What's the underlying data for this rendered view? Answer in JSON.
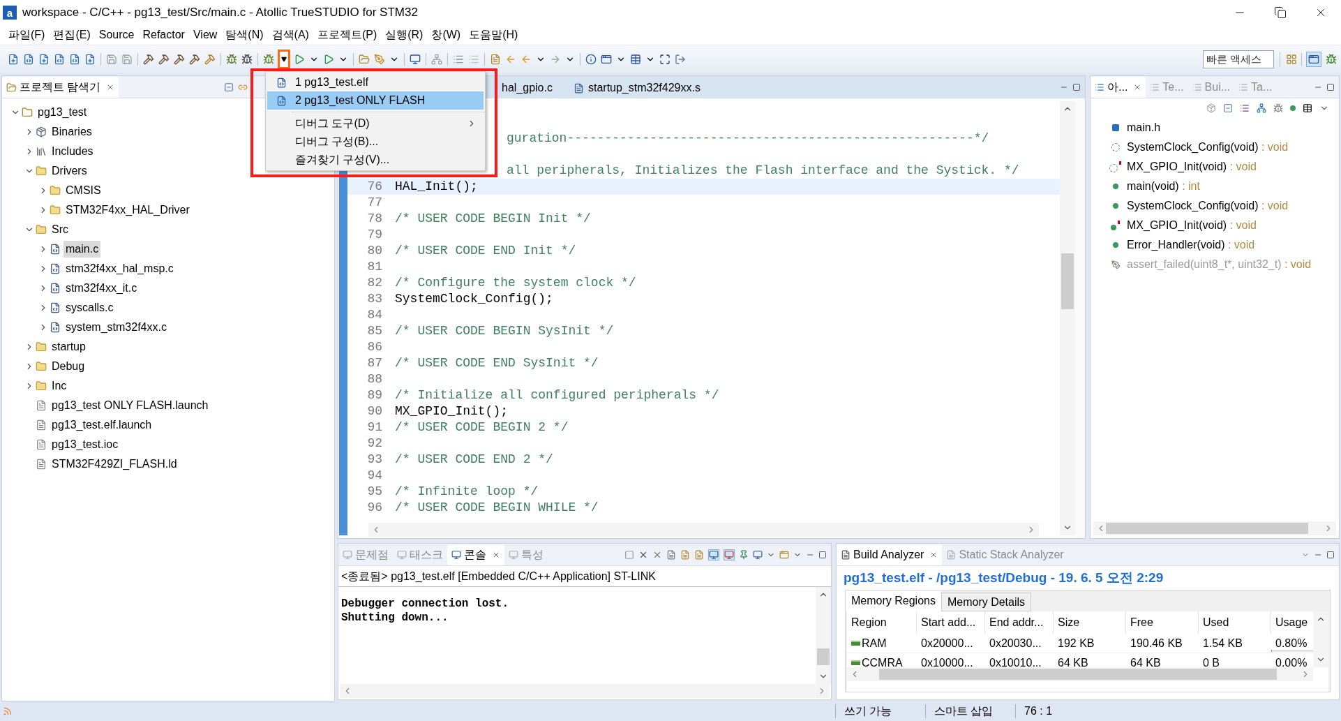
{
  "window": {
    "logo": "a",
    "title": "workspace - C/C++ - pg13_test/Src/main.c - Atollic TrueSTUDIO for STM32"
  },
  "menu_bar": [
    "파일(F)",
    "편집(E)",
    "Source",
    "Refactor",
    "View",
    "탐색(N)",
    "검색(A)",
    "프로젝트(P)",
    "실행(R)",
    "창(W)",
    "도움말(H)"
  ],
  "toolbar": {
    "quick_access": {
      "placeholder": "빠른 액세스"
    }
  },
  "debug_menu": {
    "items": [
      {
        "kind": "launch",
        "label": "1 pg13_test.elf",
        "selected": false
      },
      {
        "kind": "launch",
        "label": "2 pg13_test ONLY FLASH",
        "selected": true
      },
      {
        "kind": "separator"
      },
      {
        "kind": "submenu",
        "label": "디버그 도구(D)",
        "selected": false
      },
      {
        "kind": "plain",
        "label": "디버그 구성(B)...",
        "selected": false
      },
      {
        "kind": "plain",
        "label": "즐겨찾기 구성(V)...",
        "selected": false
      }
    ]
  },
  "project_explorer": {
    "tab": "프로젝트 탐색기",
    "tree": [
      {
        "kind": "project",
        "label": "pg13_test",
        "expanded": true,
        "selected": false,
        "children": [
          {
            "kind": "binaries",
            "label": "Binaries",
            "expanded": false,
            "selected": false
          },
          {
            "kind": "includes",
            "label": "Includes",
            "expanded": false,
            "selected": false
          },
          {
            "kind": "folder",
            "label": "Drivers",
            "expanded": true,
            "selected": false,
            "children": [
              {
                "kind": "folder",
                "label": "CMSIS",
                "expanded": false,
                "selected": false
              },
              {
                "kind": "folder",
                "label": "STM32F4xx_HAL_Driver",
                "expanded": false,
                "selected": false
              }
            ]
          },
          {
            "kind": "folder",
            "label": "Src",
            "expanded": true,
            "selected": false,
            "children": [
              {
                "kind": "source",
                "label": "main.c",
                "expanded": false,
                "selected": true
              },
              {
                "kind": "source",
                "label": "stm32f4xx_hal_msp.c",
                "expanded": false,
                "selected": false
              },
              {
                "kind": "source",
                "label": "stm32f4xx_it.c",
                "expanded": false,
                "selected": false
              },
              {
                "kind": "source",
                "label": "syscalls.c",
                "expanded": false,
                "selected": false
              },
              {
                "kind": "source",
                "label": "system_stm32f4xx.c",
                "expanded": false,
                "selected": false
              }
            ]
          },
          {
            "kind": "folder",
            "label": "startup",
            "expanded": false,
            "selected": false
          },
          {
            "kind": "folder",
            "label": "Debug",
            "expanded": false,
            "selected": false
          },
          {
            "kind": "folder",
            "label": "Inc",
            "expanded": false,
            "selected": false
          },
          {
            "kind": "file",
            "label": "pg13_test ONLY FLASH.launch",
            "selected": false
          },
          {
            "kind": "file",
            "label": "pg13_test.elf.launch",
            "selected": false
          },
          {
            "kind": "file",
            "label": "pg13_test.ioc",
            "selected": false
          },
          {
            "kind": "file",
            "label": "STM32F429ZI_FLASH.ld",
            "selected": false
          }
        ]
      }
    ]
  },
  "editor": {
    "tabs": [
      {
        "label": "hal_gpio.c",
        "selected": false
      },
      {
        "label": "startup_stm32f429xx.s",
        "selected": false
      }
    ],
    "lines": [
      {
        "kind": "clipped",
        "text": "guration------------------------------------------------------*/",
        "current": false
      },
      {
        "kind": "clipped",
        "text": "all peripherals, Initializes the Flash interface and the Systick. */",
        "current": false
      },
      {
        "kind": "code",
        "number": "76",
        "text": "HAL_Init();",
        "current": true
      },
      {
        "kind": "blank",
        "number": "77",
        "current": false
      },
      {
        "kind": "comment",
        "number": "78",
        "text": "/* USER CODE BEGIN Init */",
        "current": false
      },
      {
        "kind": "blank",
        "number": "79",
        "current": false
      },
      {
        "kind": "comment",
        "number": "80",
        "text": "/* USER CODE END Init */",
        "current": false
      },
      {
        "kind": "blank",
        "number": "81",
        "current": false
      },
      {
        "kind": "comment",
        "number": "82",
        "text": "/* Configure the system clock */",
        "current": false
      },
      {
        "kind": "code",
        "number": "83",
        "text": "SystemClock_Config();",
        "current": false
      },
      {
        "kind": "blank",
        "number": "84",
        "current": false
      },
      {
        "kind": "comment",
        "number": "85",
        "text": "/* USER CODE BEGIN SysInit */",
        "current": false
      },
      {
        "kind": "blank",
        "number": "86",
        "current": false
      },
      {
        "kind": "comment",
        "number": "87",
        "text": "/* USER CODE END SysInit */",
        "current": false
      },
      {
        "kind": "blank",
        "number": "88",
        "current": false
      },
      {
        "kind": "comment",
        "number": "89",
        "text": "/* Initialize all configured peripherals */",
        "current": false
      },
      {
        "kind": "code",
        "number": "90",
        "text": "MX_GPIO_Init();",
        "current": false
      },
      {
        "kind": "comment",
        "number": "91",
        "text": "/* USER CODE BEGIN 2 */",
        "current": false
      },
      {
        "kind": "blank",
        "number": "92",
        "current": false
      },
      {
        "kind": "comment",
        "number": "93",
        "text": "/* USER CODE END 2 */",
        "current": false
      },
      {
        "kind": "blank",
        "number": "94",
        "current": false
      },
      {
        "kind": "comment",
        "number": "95",
        "text": "/* Infinite loop */",
        "current": false
      },
      {
        "kind": "comment",
        "number": "96",
        "text": "/* USER CODE BEGIN WHILE */",
        "current": false
      }
    ]
  },
  "outline": {
    "tabs": [
      {
        "label": "아...",
        "selected": true
      },
      {
        "label": "Te...",
        "selected": false
      },
      {
        "label": "Bui...",
        "selected": false
      },
      {
        "label": "Ta...",
        "selected": false
      }
    ],
    "items": [
      {
        "kind": "include",
        "name": "main.h"
      },
      {
        "kind": "declaration",
        "name": "SystemClock_Config(void)",
        "type": ": void"
      },
      {
        "kind": "static-declaration",
        "name": "MX_GPIO_Init(void)",
        "type": ": void"
      },
      {
        "kind": "function",
        "name": "main(void)",
        "type": ": int"
      },
      {
        "kind": "function",
        "name": "SystemClock_Config(void)",
        "type": ": void"
      },
      {
        "kind": "static-function",
        "name": "MX_GPIO_Init(void)",
        "type": ": void"
      },
      {
        "kind": "function",
        "name": "Error_Handler(void)",
        "type": ": void"
      },
      {
        "kind": "inactive",
        "name": "assert_failed(uint8_t*, uint32_t)",
        "type": ": void"
      }
    ]
  },
  "console": {
    "tabs": [
      {
        "label": "문제점",
        "selected": false
      },
      {
        "label": "태스크",
        "selected": false
      },
      {
        "label": "콘솔",
        "selected": true
      },
      {
        "label": "특성",
        "selected": false
      }
    ],
    "status": "<종료됨> pg13_test.elf [Embedded C/C++ Application] ST-LINK",
    "output": [
      "Debugger connection lost.",
      "Shutting down..."
    ]
  },
  "build_analyzer": {
    "tabs": [
      {
        "label": "Build Analyzer",
        "selected": true
      },
      {
        "label": "Static Stack Analyzer",
        "selected": false
      }
    ],
    "heading": "pg13_test.elf - /pg13_test/Debug - 19. 6. 5 오전 2:29",
    "subtabs": [
      {
        "label": "Memory Regions",
        "selected": true
      },
      {
        "label": "Memory Details",
        "selected": false
      }
    ],
    "columns": [
      "Region",
      "Start add...",
      "End addr...",
      "Size",
      "Free",
      "Used",
      "Usage"
    ],
    "rows": [
      {
        "cells": [
          "RAM",
          "0x20000...",
          "0x20030...",
          "192 KB",
          "190.46 KB",
          "1.54 KB"
        ],
        "usage": "0.80%",
        "level": 0.008
      },
      {
        "cells": [
          "CCMRA",
          "0x10000...",
          "0x10010...",
          "64 KB",
          "64 KB",
          "0 B"
        ],
        "usage": "0.00%",
        "level": 0
      }
    ]
  },
  "status_bar": [
    "쓰기 가능",
    "스마트 삽입",
    "76 : 1"
  ]
}
